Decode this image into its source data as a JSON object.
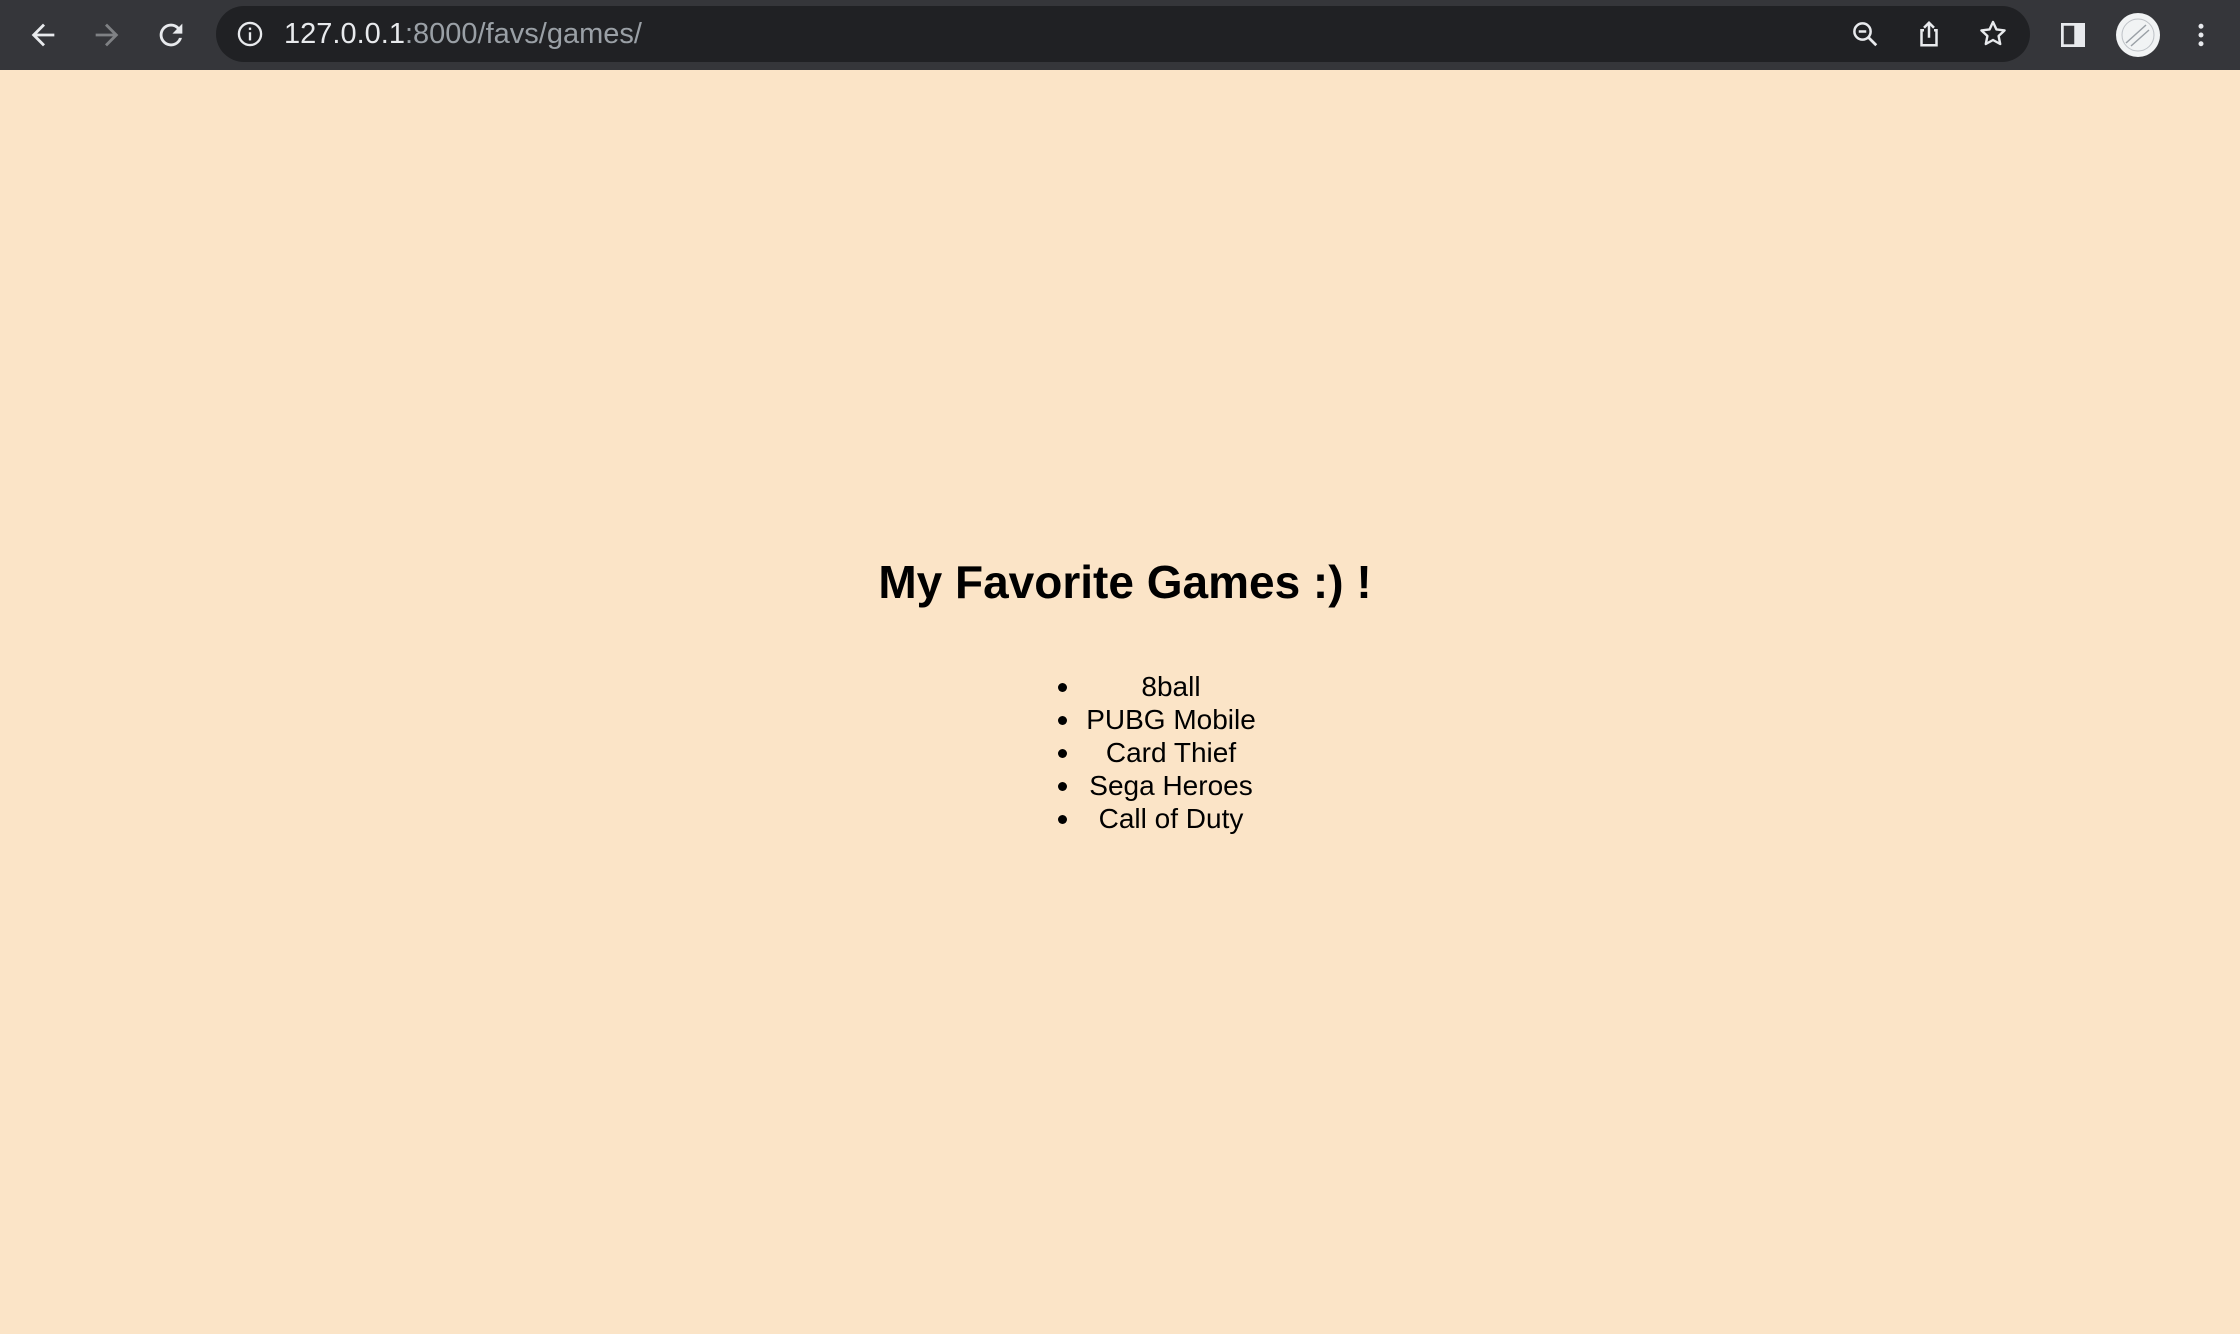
{
  "browser": {
    "url_host": "127.0.0.1",
    "url_path": ":8000/favs/games/",
    "icons": [
      "back-icon",
      "forward-icon",
      "reload-icon",
      "site-info-icon",
      "zoom-icon",
      "share-icon",
      "bookmark-star-icon",
      "side-panel-icon",
      "profile-avatar",
      "menu-kebab-icon"
    ]
  },
  "page": {
    "background_color": "#fbe4c7",
    "title": "My Favorite Games :) !",
    "games": [
      "8ball",
      "PUBG Mobile",
      "Card Thief",
      "Sega Heroes",
      "Call of Duty"
    ]
  }
}
